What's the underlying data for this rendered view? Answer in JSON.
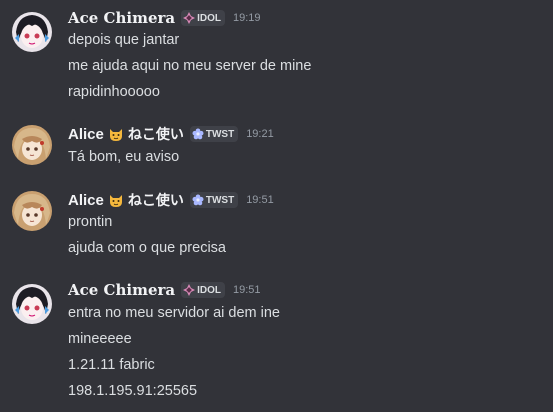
{
  "messages": [
    {
      "author": "Ace Chimera",
      "badge": "IDOL",
      "time": "19:19",
      "lines": [
        "depois que jantar",
        "me ajuda aqui no meu server de mine",
        "rapidinhooooo"
      ]
    },
    {
      "author": "Alice",
      "author_suffix": "ねこ使い",
      "badge": "TWST",
      "time": "19:21",
      "lines": [
        "Tá bom, eu aviso"
      ]
    },
    {
      "author": "Alice",
      "author_suffix": "ねこ使い",
      "badge": "TWST",
      "time": "19:51",
      "lines": [
        "prontin",
        "ajuda com o que precisa"
      ]
    },
    {
      "author": "Ace Chimera",
      "badge": "IDOL",
      "time": "19:51",
      "lines": [
        "entra no meu servidor ai dem ine",
        "mineeeee",
        "1.21.11 fabric",
        "198.1.195.91:25565"
      ]
    }
  ],
  "icons": {
    "idol_badge": "diamond-sparkle-icon",
    "twst_badge": "flower-icon",
    "name_emoji": "cat-face-icon"
  },
  "colors": {
    "background": "#323339",
    "username": "#f2f3f5",
    "text": "#dbdee1",
    "timestamp": "#949ba4",
    "badge_bg": "#3f4148",
    "idol_icon": "#d98ab8",
    "twst_icon": "#a9b8ff"
  }
}
